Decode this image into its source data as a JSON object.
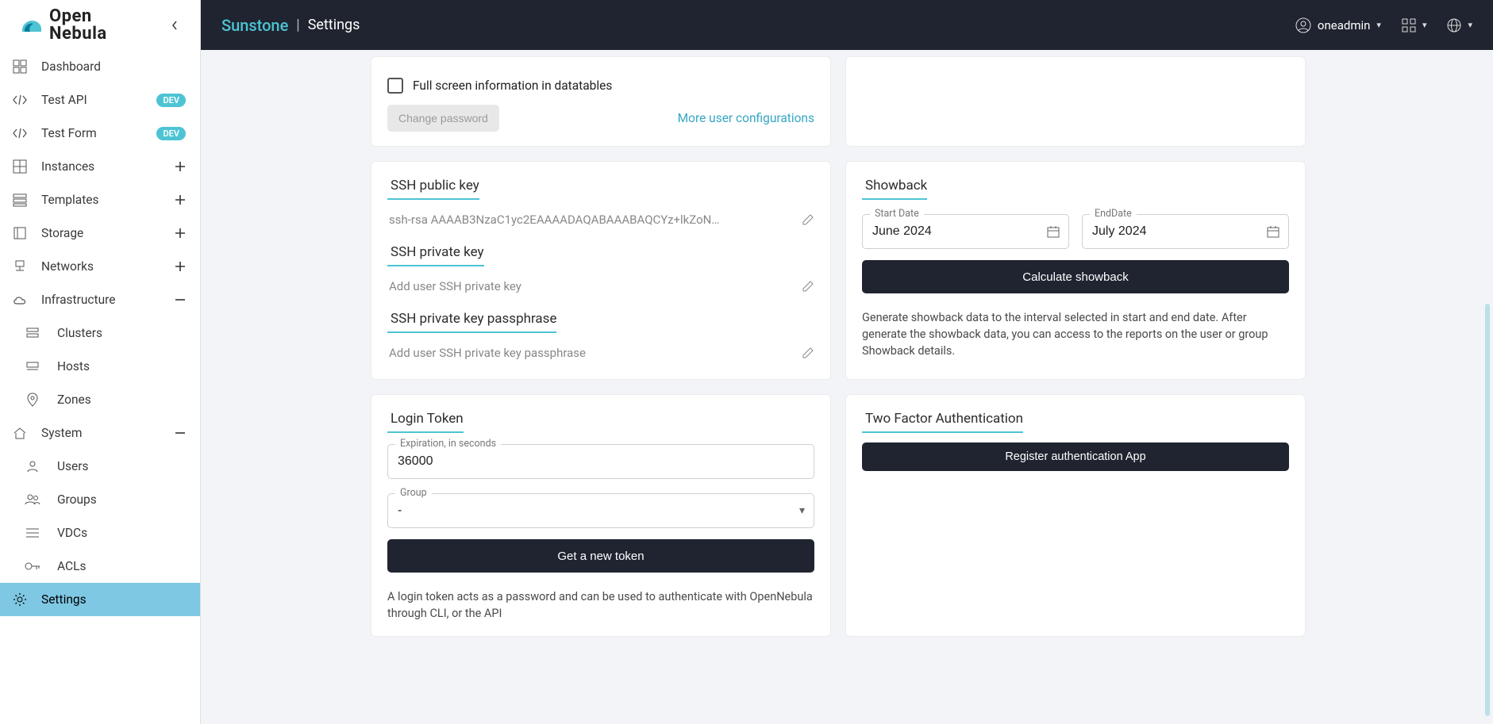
{
  "topbar": {
    "brand": "Sunstone",
    "section": "Settings",
    "user": "oneadmin"
  },
  "sidebar": {
    "items": [
      {
        "key": "dashboard",
        "label": "Dashboard"
      },
      {
        "key": "test-api",
        "label": "Test API",
        "badge": "DEV"
      },
      {
        "key": "test-form",
        "label": "Test Form",
        "badge": "DEV"
      },
      {
        "key": "instances",
        "label": "Instances",
        "expand": "plus"
      },
      {
        "key": "templates",
        "label": "Templates",
        "expand": "plus"
      },
      {
        "key": "storage",
        "label": "Storage",
        "expand": "plus"
      },
      {
        "key": "networks",
        "label": "Networks",
        "expand": "plus"
      },
      {
        "key": "infrastructure",
        "label": "Infrastructure",
        "expand": "minus"
      },
      {
        "key": "clusters",
        "label": "Clusters",
        "sub": true
      },
      {
        "key": "hosts",
        "label": "Hosts",
        "sub": true
      },
      {
        "key": "zones",
        "label": "Zones",
        "sub": true
      },
      {
        "key": "system",
        "label": "System",
        "expand": "minus"
      },
      {
        "key": "users",
        "label": "Users",
        "sub": true
      },
      {
        "key": "groups",
        "label": "Groups",
        "sub": true
      },
      {
        "key": "vdcs",
        "label": "VDCs",
        "sub": true
      },
      {
        "key": "acls",
        "label": "ACLs",
        "sub": true
      },
      {
        "key": "settings",
        "label": "Settings",
        "active": true
      }
    ]
  },
  "settings_top": {
    "checkbox_label": "Full screen information in datatables",
    "change_password": "Change password",
    "more_link": "More user configurations"
  },
  "ssh": {
    "title_public": "SSH public key",
    "public_value": "ssh-rsa AAAAB3NzaC1yc2EAAAADAQABAAABAQCYz+lkZoN…",
    "title_private": "SSH private key",
    "private_placeholder": "Add user SSH private key",
    "title_passphrase": "SSH private key passphrase",
    "passphrase_placeholder": "Add user SSH private key passphrase"
  },
  "showback": {
    "title": "Showback",
    "start_label": "Start Date",
    "start_value": "June 2024",
    "end_label": "EndDate",
    "end_value": "July 2024",
    "button": "Calculate showback",
    "helper": "Generate showback data to the interval selected in start and end date. After generate the showback data, you can access to the reports on the user or group Showback details."
  },
  "login_token": {
    "title": "Login Token",
    "exp_label": "Expiration, in seconds",
    "exp_value": "36000",
    "group_label": "Group",
    "group_value": "-",
    "button": "Get a new token",
    "helper": "A login token acts as a password and can be used to authenticate with OpenNebula through CLI, or the API"
  },
  "tfa": {
    "title": "Two Factor Authentication",
    "button": "Register authentication App"
  }
}
